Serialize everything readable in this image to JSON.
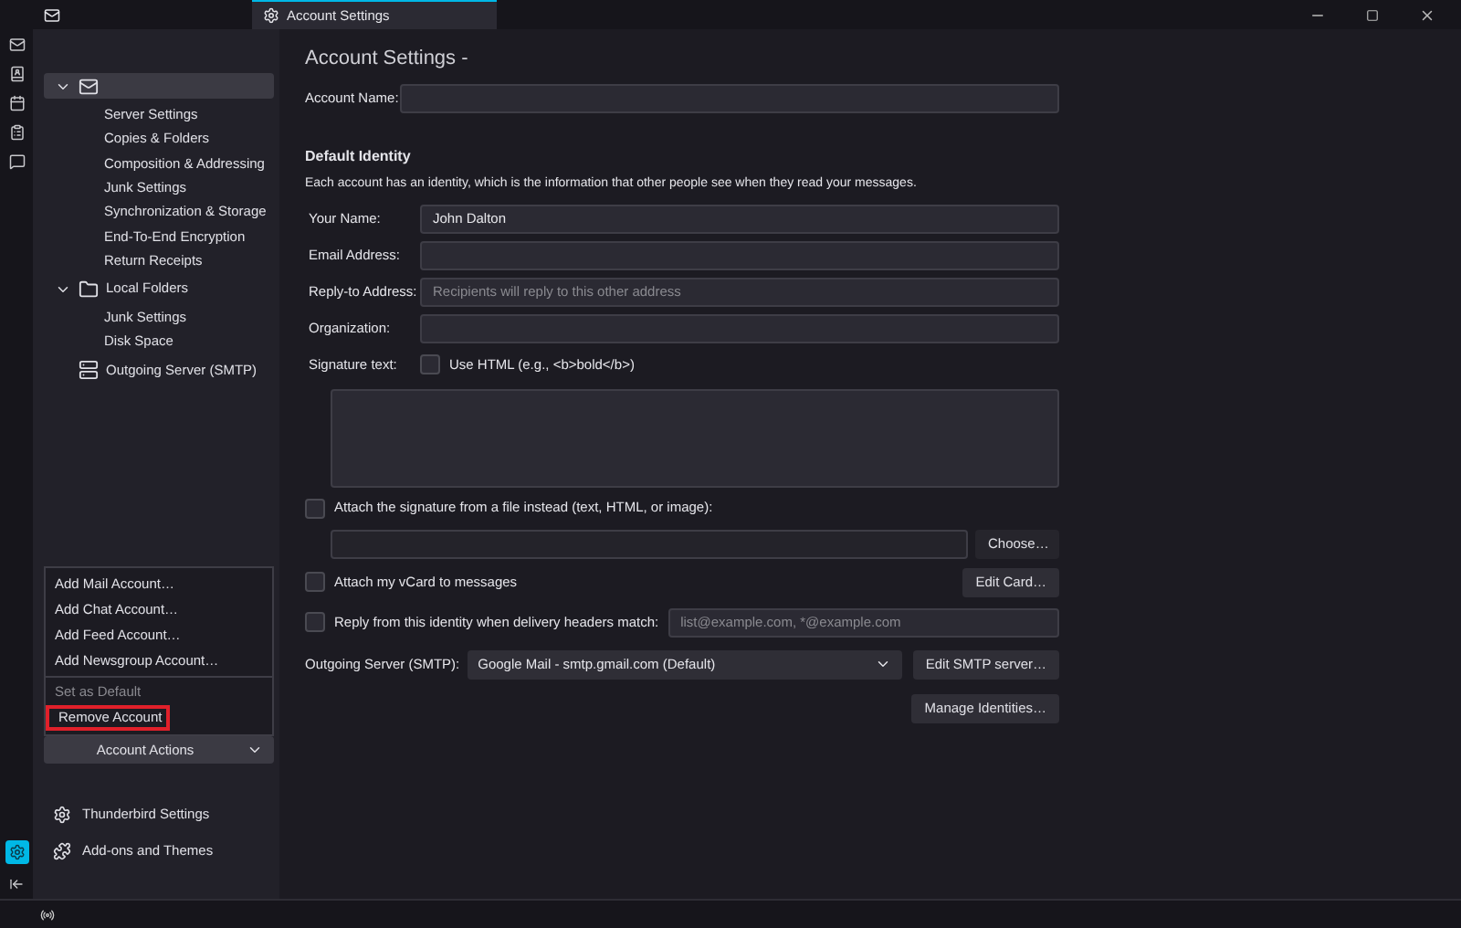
{
  "titlebar": {
    "tabs": [
      {
        "kind": "mail",
        "selected": false
      },
      {
        "kind": "settings",
        "label": "Account Settings",
        "selected": true
      }
    ]
  },
  "sidebar": {
    "tree": [
      {
        "kind": "account",
        "selected": true,
        "expanded": true,
        "children": [
          {
            "label": "Server Settings"
          },
          {
            "label": "Copies & Folders"
          },
          {
            "label": "Composition & Addressing"
          },
          {
            "label": "Junk Settings"
          },
          {
            "label": "Synchronization & Storage"
          },
          {
            "label": "End-To-End Encryption"
          },
          {
            "label": "Return Receipts"
          }
        ]
      },
      {
        "kind": "folder",
        "label": "Local Folders",
        "selected": false,
        "expanded": true,
        "children": [
          {
            "label": "Junk Settings"
          },
          {
            "label": "Disk Space"
          }
        ]
      },
      {
        "kind": "server",
        "label": "Outgoing Server (SMTP)",
        "selected": false
      }
    ],
    "menu": [
      {
        "label": "Add Mail Account…",
        "disabled": false,
        "highlighted": false
      },
      {
        "label": "Add Chat Account…",
        "disabled": false,
        "highlighted": false
      },
      {
        "label": "Add Feed Account…",
        "disabled": false,
        "highlighted": false
      },
      {
        "label": "Add Newsgroup Account…",
        "disabled": false,
        "highlighted": false,
        "separator_after": true
      },
      {
        "label": "Set as Default",
        "disabled": true,
        "highlighted": false
      },
      {
        "label": "Remove Account",
        "disabled": false,
        "highlighted": true
      }
    ],
    "account_actions": "Account Actions",
    "footer": [
      {
        "kind": "gear",
        "label": "Thunderbird Settings"
      },
      {
        "kind": "puzzle",
        "label": "Add-ons and Themes"
      }
    ]
  },
  "main": {
    "title": "Account Settings -",
    "account_name_label": "Account Name:",
    "section": "Default Identity",
    "description": "Each account has an identity, which is the information that other people see when they read your messages.",
    "fields": [
      {
        "label": "Your Name:",
        "value": "John Dalton"
      },
      {
        "label": "Email Address:"
      },
      {
        "label": "Reply-to Address:",
        "placeholder": "Recipients will reply to this other address"
      },
      {
        "label": "Organization:"
      }
    ],
    "signature_label": "Signature text:",
    "use_html": {
      "label": "Use HTML (e.g., <b>bold</b>)",
      "checked": false
    },
    "attach_signature": {
      "label": "Attach the signature from a file instead (text, HTML, or image):",
      "checked": false
    },
    "choose_button": "Choose…",
    "vcard": {
      "label": "Attach my vCard to messages",
      "checked": false
    },
    "edit_card_button": "Edit Card…",
    "reply_from": {
      "label": "Reply from this identity when delivery headers match:",
      "checked": false,
      "placeholder": "list@example.com, *@example.com"
    },
    "outgoing_label": "Outgoing Server (SMTP):",
    "outgoing_value": "Google Mail - smtp.gmail.com (Default)",
    "edit_smtp_button": "Edit SMTP server…",
    "manage_button": "Manage Identities…"
  }
}
